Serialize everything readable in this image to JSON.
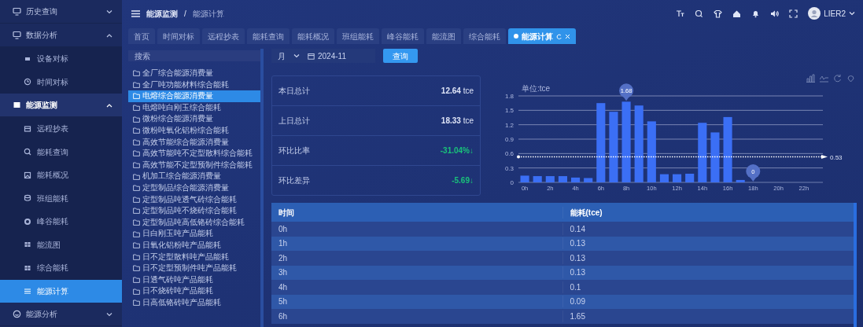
{
  "sidebar": {
    "items": [
      {
        "label": "历史查询",
        "expanded": false
      },
      {
        "label": "数据分析",
        "expanded": true,
        "children": [
          {
            "label": "设备对标",
            "selected": false
          },
          {
            "label": "时间对标",
            "selected": false
          }
        ]
      },
      {
        "label": "能源监测",
        "expanded": true,
        "children": [
          {
            "label": "远程抄表",
            "selected": false
          },
          {
            "label": "能耗查询",
            "selected": false
          },
          {
            "label": "能耗概况",
            "selected": false
          },
          {
            "label": "班组能耗",
            "selected": false
          },
          {
            "label": "峰谷能耗",
            "selected": false
          },
          {
            "label": "能流图",
            "selected": false
          },
          {
            "label": "综合能耗",
            "selected": false
          },
          {
            "label": "能源计算",
            "selected": true
          }
        ]
      },
      {
        "label": "能源分析",
        "expanded": false
      }
    ]
  },
  "header": {
    "breadcrumb": [
      "能源监测",
      "能源计算"
    ],
    "separator": "/",
    "user": "LIER2"
  },
  "tabs": [
    {
      "label": "首页",
      "selected": false
    },
    {
      "label": "时间对标",
      "selected": false
    },
    {
      "label": "远程抄表",
      "selected": false
    },
    {
      "label": "能耗查询",
      "selected": false
    },
    {
      "label": "能耗概况",
      "selected": false
    },
    {
      "label": "班组能耗",
      "selected": false
    },
    {
      "label": "峰谷能耗",
      "selected": false
    },
    {
      "label": "能流图",
      "selected": false
    },
    {
      "label": "综合能耗",
      "selected": false
    },
    {
      "label": "能源计算",
      "selected": true
    }
  ],
  "tree": {
    "placeholder": "搜索",
    "items": [
      {
        "label": "全厂综合能源消费量",
        "selected": false
      },
      {
        "label": "全厂吨功能材料综合能耗",
        "selected": false
      },
      {
        "label": "电熔综合能源消费量",
        "selected": true
      },
      {
        "label": "电熔吨白刚玉综合能耗",
        "selected": false
      },
      {
        "label": "微粉综合能源消费量",
        "selected": false
      },
      {
        "label": "微粉吨氧化铝粉综合能耗",
        "selected": false
      },
      {
        "label": "高效节能综合能源消费量",
        "selected": false
      },
      {
        "label": "高效节能吨不定型散料综合能耗",
        "selected": false
      },
      {
        "label": "高效节能不定型预制件综合能耗",
        "selected": false
      },
      {
        "label": "机加工综合能源消费量",
        "selected": false
      },
      {
        "label": "定型制品综合能源消费量",
        "selected": false
      },
      {
        "label": "定型制品吨透气砖综合能耗",
        "selected": false
      },
      {
        "label": "定型制品吨不烧砖综合能耗",
        "selected": false
      },
      {
        "label": "定型制品吨高低铬砖综合能耗",
        "selected": false
      },
      {
        "label": "日白刚玉吨产品能耗",
        "selected": false
      },
      {
        "label": "日氧化铝粉吨产品能耗",
        "selected": false
      },
      {
        "label": "日不定型散料吨产品能耗",
        "selected": false
      },
      {
        "label": "日不定型预制件吨产品能耗",
        "selected": false
      },
      {
        "label": "日透气砖吨产品能耗",
        "selected": false
      },
      {
        "label": "日不烧砖吨产品能耗",
        "selected": false
      },
      {
        "label": "日高低铬砖吨产品能耗",
        "selected": false
      }
    ]
  },
  "filter": {
    "period": "月",
    "date": "2024-11",
    "button": "查询"
  },
  "stats": [
    {
      "kind": "total",
      "label": "本日总计",
      "value": "12.64",
      "unit": "tce"
    },
    {
      "kind": "total",
      "label": "上日总计",
      "value": "18.33",
      "unit": "tce"
    },
    {
      "kind": "change",
      "label": "环比比率",
      "value": "-31.04%↓"
    },
    {
      "kind": "change",
      "label": "环比差异",
      "value": "-5.69↓"
    }
  ],
  "chart": {
    "chart_data": {
      "type": "bar",
      "ylabel": "单位:tce",
      "x": [
        0,
        1,
        2,
        3,
        4,
        5,
        6,
        7,
        8,
        9,
        10,
        11,
        12,
        13,
        14,
        15,
        16,
        17,
        18,
        19,
        20,
        21,
        22,
        23
      ],
      "xlim": [
        -0.5,
        23.5
      ],
      "grid": true,
      "series": [
        {
          "color": "#3b6ff5",
          "values": [
            0.14,
            0.13,
            0.13,
            0.13,
            0.1,
            0.09,
            1.65,
            1.47,
            1.68,
            1.6,
            1.27,
            0.17,
            0.17,
            0.18,
            1.24,
            1.04,
            1.36,
            0.05,
            0,
            0,
            0,
            0,
            0,
            0
          ]
        }
      ],
      "ylim": [
        0,
        1.8
      ],
      "yticks": [
        0,
        0.3,
        0.6,
        0.9,
        1.2,
        1.5,
        1.8
      ],
      "xticks": [
        {
          "value": 0,
          "label": "0h"
        },
        {
          "value": 2,
          "label": "2h"
        },
        {
          "value": 4,
          "label": "4h"
        },
        {
          "value": 6,
          "label": "6h"
        },
        {
          "value": 8,
          "label": "8h"
        },
        {
          "value": 10,
          "label": "10h"
        },
        {
          "value": 12,
          "label": "12h"
        },
        {
          "value": 14,
          "label": "14h"
        },
        {
          "value": 16,
          "label": "16h"
        },
        {
          "value": 18,
          "label": "18h"
        },
        {
          "value": 20,
          "label": "20h"
        },
        {
          "value": 22,
          "label": "22h"
        }
      ],
      "annotations": [
        {
          "x": 8,
          "y": 1.68,
          "text": "1.68"
        },
        {
          "x": 18,
          "y": 0,
          "text": "0"
        }
      ],
      "ref_lines": [
        {
          "axis": "y",
          "value": 0.53,
          "label": "0.53"
        }
      ]
    }
  },
  "table": {
    "columns": [
      "时间",
      "能耗(tce)"
    ],
    "rows": [
      [
        "0h",
        "0.14"
      ],
      [
        "1h",
        "0.13"
      ],
      [
        "2h",
        "0.13"
      ],
      [
        "3h",
        "0.13"
      ],
      [
        "4h",
        "0.1"
      ],
      [
        "5h",
        "0.09"
      ],
      [
        "6h",
        "1.65"
      ]
    ]
  }
}
